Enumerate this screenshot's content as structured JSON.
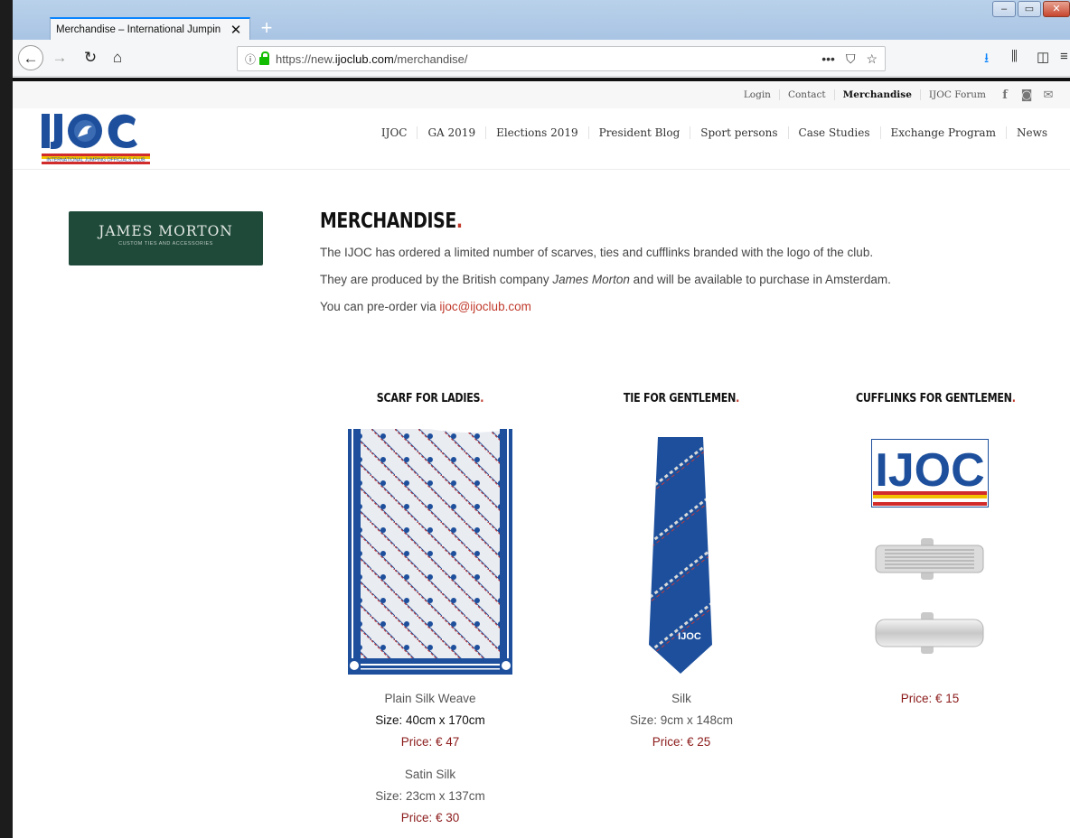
{
  "browser": {
    "tab_title": "Merchandise – International Jumpin",
    "tab_close": "✕",
    "new_tab": "+",
    "url_domain_prefix": "https://new.",
    "url_domain": "ijoclub.com",
    "url_path": "/merchandise/",
    "url_info_icon": "ⓘ",
    "url_actions": [
      "•••",
      "⛉",
      "☆"
    ],
    "toolbar_icons": [
      "download-icon",
      "library-icon",
      "sidebar-icon",
      "menu-icon"
    ],
    "window_controls": [
      "–",
      "▭",
      "✕"
    ]
  },
  "site": {
    "top_links": [
      "Login",
      "Contact",
      "Merchandise",
      "IJOC Forum"
    ],
    "active_top_link": "Merchandise",
    "social": [
      "f",
      "◙",
      "✉"
    ],
    "logo_text": "IJOC",
    "logo_sub": "INTERNATIONAL JUMPING OFFICIALS CLUB",
    "nav": [
      "IJOC",
      "GA 2019",
      "Elections 2019",
      "President Blog",
      "Sport persons",
      "Case Studies",
      "Exchange Program",
      "News"
    ]
  },
  "sponsor": {
    "name": "JAMES MORTON",
    "sub": "CUSTOM TIES AND ACCESSORIES"
  },
  "page": {
    "title": "MERCHANDISE",
    "title_dot": ".",
    "para1": "The IJOC has ordered a limited number of scarves, ties and cufflinks branded with the logo of the club.",
    "para2_before": "They are produced by the British company ",
    "para2_italic": "James Morton",
    "para2_after": " and will be available to purchase in Amsterdam.",
    "para3_before": "You can pre-order via ",
    "para3_email": "ijoc@ijoclub.com"
  },
  "products": {
    "scarf": {
      "title": "SCARF FOR LADIES",
      "v1_name": "Plain Silk Weave",
      "v1_size": "Size: 40cm x 170cm",
      "v1_price": "Price: € 47",
      "v2_name": "Satin Silk",
      "v2_size": "Size: 23cm x 137cm",
      "v2_price": "Price: € 30"
    },
    "tie": {
      "title": "TIE FOR GENTLEMEN",
      "name": "Silk",
      "size": "Size: 9cm x 148cm",
      "price": "Price: € 25",
      "logo": "IJOC"
    },
    "cufflinks": {
      "title": "CUFFLINKS FOR GENTLEMEN",
      "price": "Price: € 15",
      "logo": "IJOC"
    }
  },
  "colors": {
    "accent_red": "#c0392b",
    "price": "#8b1a1a",
    "logo_blue": "#1d4f9c",
    "sponsor_green": "#1f4a3a"
  }
}
